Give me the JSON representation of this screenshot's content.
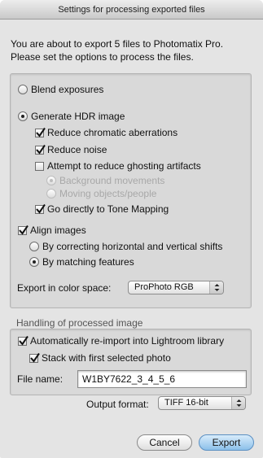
{
  "dialog": {
    "title": "Settings for processing exported files",
    "intro_line1": "You are about to export 5 files to Photomatix Pro.",
    "intro_line2": "Please set the options to process the files."
  },
  "processing": {
    "blend_exposures": "Blend exposures",
    "generate_hdr": "Generate HDR image",
    "reduce_chromatic": "Reduce chromatic aberrations",
    "reduce_noise": "Reduce noise",
    "reduce_ghosting": "Attempt to reduce ghosting artifacts",
    "background_movements": "Background movements",
    "moving_objects": "Moving objects/people",
    "go_tone_mapping": "Go directly to Tone Mapping",
    "align_images": "Align images",
    "align_shifts": "By correcting horizontal and vertical shifts",
    "align_features": "By matching features",
    "color_space_label": "Export in color space:",
    "color_space_value": "ProPhoto RGB"
  },
  "handling": {
    "section_label": "Handling of processed image",
    "reimport": "Automatically re-import into Lightroom library",
    "stack": "Stack with first selected photo",
    "file_name_label": "File name:",
    "file_name_value": "W1BY7622_3_4_5_6",
    "output_format_label": "Output format:",
    "output_format_value": "TIFF 16-bit"
  },
  "buttons": {
    "cancel": "Cancel",
    "export": "Export"
  }
}
